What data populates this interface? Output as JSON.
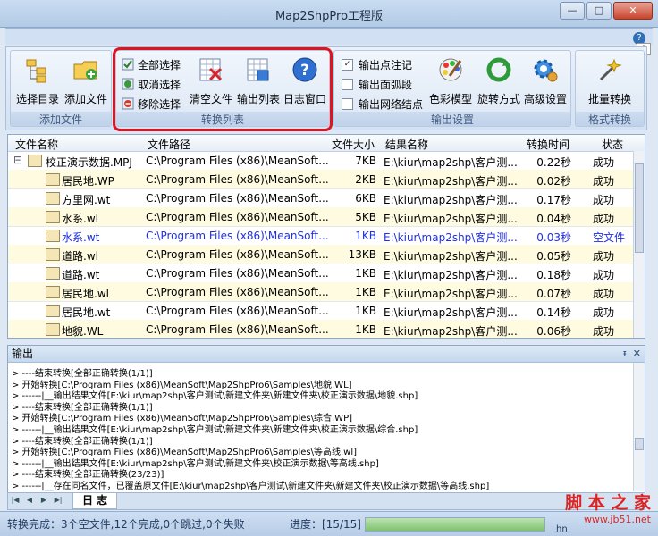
{
  "window": {
    "title": "Map2ShpPro工程版",
    "min": "—",
    "max": "□",
    "close": "✕"
  },
  "ribbon": {
    "help": "?",
    "tag": "A",
    "groups": {
      "add": {
        "label": "添加文件",
        "select_dir": "选择目录",
        "add_file": "添加文件"
      },
      "list": {
        "label": "转换列表",
        "select_all": "全部选择",
        "deselect": "取消选择",
        "remove": "移除选择",
        "clear": "清空文件",
        "export_list": "输出列表",
        "log_window": "日志窗口"
      },
      "output": {
        "label": "输出设置",
        "opt_points": "输出点注记",
        "opt_arcs": "输出面弧段",
        "opt_nodes": "输出网络结点",
        "color_mode": "色彩模型",
        "rotate": "旋转方式",
        "advanced": "高级设置"
      },
      "format": {
        "label": "格式转换",
        "batch": "批量转换"
      }
    }
  },
  "grid": {
    "columns": [
      "文件名称",
      "文件路径",
      "文件大小",
      "结果名称",
      "转换时间",
      "状态"
    ],
    "rows": [
      {
        "name": "校正演示数据.MPJ",
        "path": "C:\\Program Files (x86)\\MeanSoft...",
        "size": "7KB",
        "result": "E:\\kiur\\map2shp\\客户测...",
        "time": "0.22秒",
        "status": "成功",
        "expander": "⊟"
      },
      {
        "name": "居民地.WP",
        "path": "C:\\Program Files (x86)\\MeanSoft...",
        "size": "2KB",
        "result": "E:\\kiur\\map2shp\\客户测...",
        "time": "0.02秒",
        "status": "成功"
      },
      {
        "name": "方里网.wt",
        "path": "C:\\Program Files (x86)\\MeanSoft...",
        "size": "6KB",
        "result": "E:\\kiur\\map2shp\\客户测...",
        "time": "0.17秒",
        "status": "成功"
      },
      {
        "name": "水系.wl",
        "path": "C:\\Program Files (x86)\\MeanSoft...",
        "size": "5KB",
        "result": "E:\\kiur\\map2shp\\客户测...",
        "time": "0.04秒",
        "status": "成功"
      },
      {
        "name": "水系.wt",
        "path": "C:\\Program Files (x86)\\MeanSoft...",
        "size": "1KB",
        "result": "E:\\kiur\\map2shp\\客户测...",
        "time": "0.03秒",
        "status": "空文件"
      },
      {
        "name": "道路.wl",
        "path": "C:\\Program Files (x86)\\MeanSoft...",
        "size": "13KB",
        "result": "E:\\kiur\\map2shp\\客户测...",
        "time": "0.05秒",
        "status": "成功"
      },
      {
        "name": "道路.wt",
        "path": "C:\\Program Files (x86)\\MeanSoft...",
        "size": "1KB",
        "result": "E:\\kiur\\map2shp\\客户测...",
        "time": "0.18秒",
        "status": "成功"
      },
      {
        "name": "居民地.wl",
        "path": "C:\\Program Files (x86)\\MeanSoft...",
        "size": "1KB",
        "result": "E:\\kiur\\map2shp\\客户测...",
        "time": "0.07秒",
        "status": "成功"
      },
      {
        "name": "居民地.wt",
        "path": "C:\\Program Files (x86)\\MeanSoft...",
        "size": "1KB",
        "result": "E:\\kiur\\map2shp\\客户测...",
        "time": "0.14秒",
        "status": "成功"
      },
      {
        "name": "地貌.WL",
        "path": "C:\\Program Files (x86)\\MeanSoft...",
        "size": "1KB",
        "result": "E:\\kiur\\map2shp\\客户测...",
        "time": "0.06秒",
        "status": "成功"
      }
    ]
  },
  "output": {
    "title": "输出",
    "pin": "ᵻ",
    "close": "✕",
    "lines": [
      "> ----结束转换[全部正确转换(1/1)]",
      "> 开始转换[C:\\Program Files (x86)\\MeanSoft\\Map2ShpPro6\\Samples\\地貌.WL]",
      "> ------|__输出结果文件[E:\\kiur\\map2shp\\客户测试\\新建文件夹\\新建文件夹\\校正演示数据\\地貌.shp]",
      "> ----结束转换[全部正确转换(1/1)]",
      "> 开始转换[C:\\Program Files (x86)\\MeanSoft\\Map2ShpPro6\\Samples\\综合.WP]",
      "> ------|__输出结果文件[E:\\kiur\\map2shp\\客户测试\\新建文件夹\\新建文件夹\\校正演示数据\\综合.shp]",
      "> ----结束转换[全部正确转换(1/1)]",
      "> 开始转换[C:\\Program Files (x86)\\MeanSoft\\Map2ShpPro6\\Samples\\等高线.wl]",
      "> ------|__输出结果文件[E:\\kiur\\map2shp\\客户测试\\新建文件夹\\校正演示数据\\等高线.shp]",
      "> ----结束转换[全部正确转换(23/23)]",
      "> ------|__存在同名文件，已覆盖原文件[E:\\kiur\\map2shp\\客户测试\\新建文件夹\\新建文件夹\\校正演示数据\\等高线.shp]"
    ]
  },
  "logtabs": {
    "nav_first": "|◀",
    "nav_prev": "◀",
    "nav_next": "▶",
    "nav_last": "▶|",
    "log_tab": "日 志"
  },
  "status": {
    "summary": "转换完成：3个空文件,12个完成,0个跳过,0个失败",
    "progress_label": "进度：[15/15]",
    "progress": 1.0,
    "trailing": "hn"
  },
  "watermark": {
    "line1": "脚 本 之 家",
    "line2": "www.jb51.net"
  }
}
